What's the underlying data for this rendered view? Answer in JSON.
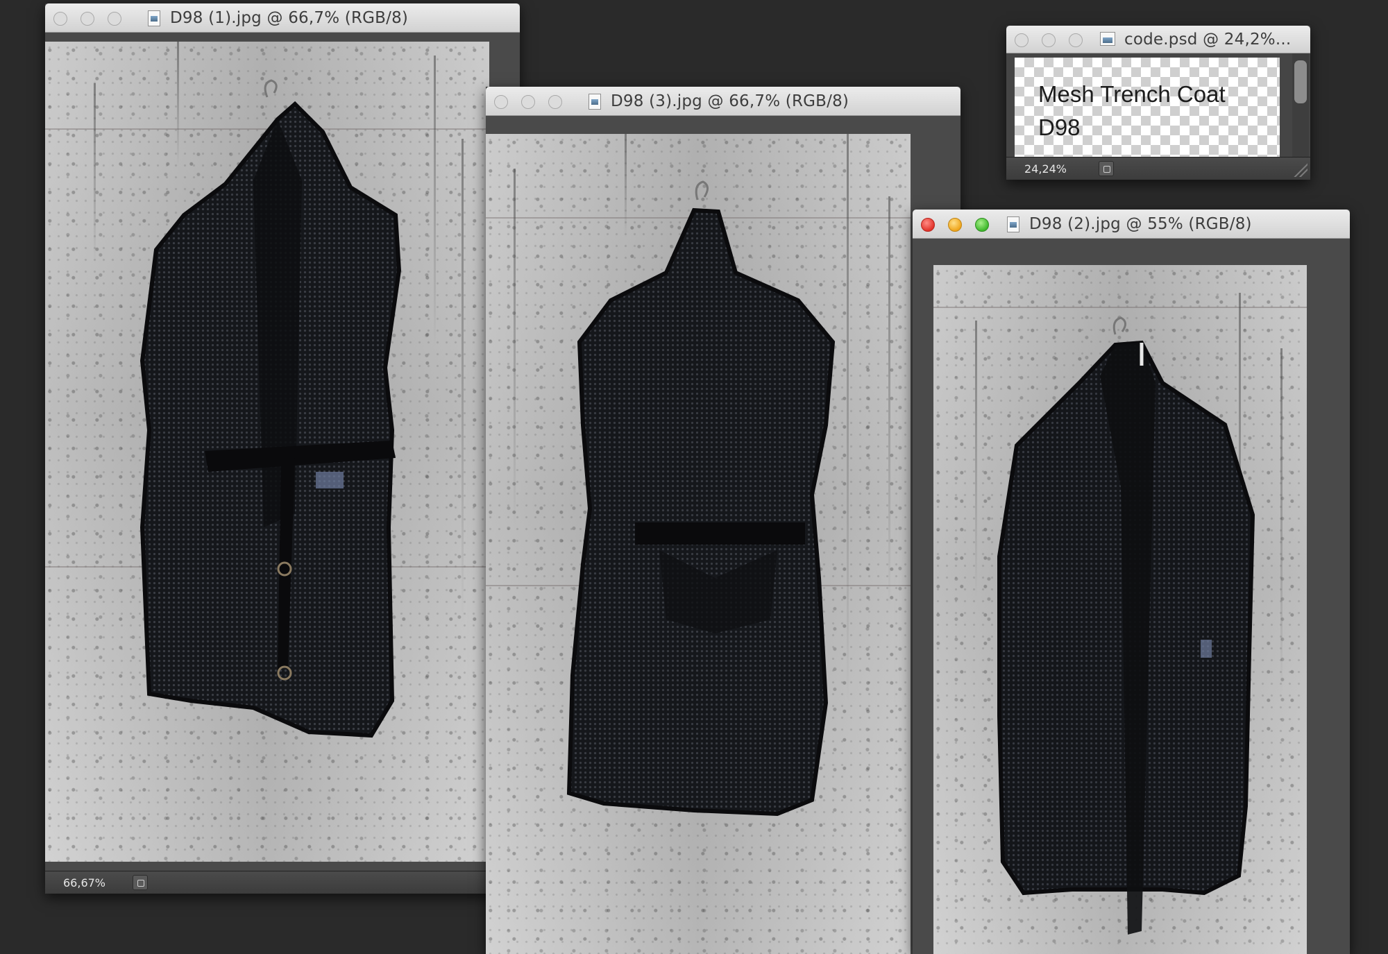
{
  "windows": {
    "d98_1": {
      "title": "D98 (1).jpg @ 66,7% (RGB/8)",
      "zoom": "66,67%"
    },
    "d98_3": {
      "title": "D98 (3).jpg @ 66,7% (RGB/8)"
    },
    "d98_2": {
      "title": "D98 (2).jpg @ 55% (RGB/8)"
    },
    "code_psd": {
      "title": "code.psd @ 24,2%...",
      "text_line_1": "Mesh Trench Coat",
      "text_line_2": "D98",
      "zoom": "24,24%"
    }
  },
  "colors": {
    "desktop": "#2a2a2a",
    "close": "#e2342b",
    "minimize": "#efa51b",
    "zoom": "#3fb82c",
    "garment": "#15171b"
  }
}
